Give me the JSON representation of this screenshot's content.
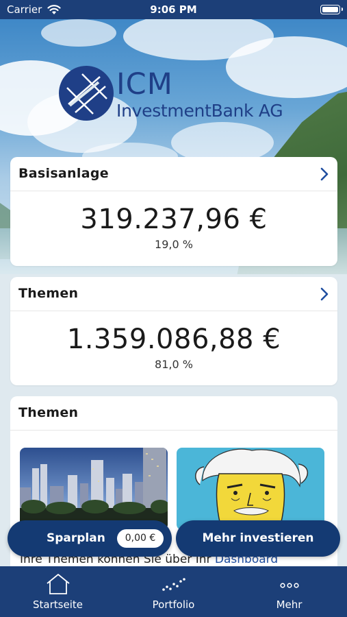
{
  "status": {
    "carrier": "Carrier",
    "time": "9:06 PM"
  },
  "logo": {
    "brand": "ICM",
    "subtitle": "InvestmentBank AG"
  },
  "cards": [
    {
      "title": "Basisanlage",
      "amount": "319.237,96 €",
      "percent": "19,0 %"
    },
    {
      "title": "Themen",
      "amount": "1.359.086,88 €",
      "percent": "81,0 %"
    }
  ],
  "themes": {
    "title": "Themen",
    "note_text": "Ihre Themen können Sie über Ihr ",
    "note_link": "Dashboard"
  },
  "actions": {
    "sparplan_label": "Sparplan",
    "sparplan_value": "0,00 €",
    "invest_label": "Mehr investieren"
  },
  "tabs": [
    {
      "label": "Startseite",
      "icon": "house-icon"
    },
    {
      "label": "Portfolio",
      "icon": "chart-dots-icon"
    },
    {
      "label": "Mehr",
      "icon": "more-dots-icon"
    }
  ],
  "colors": {
    "primary": "#1c3f78",
    "button": "#143a73",
    "link": "#1f4ea0",
    "brand": "#1f3f87"
  }
}
